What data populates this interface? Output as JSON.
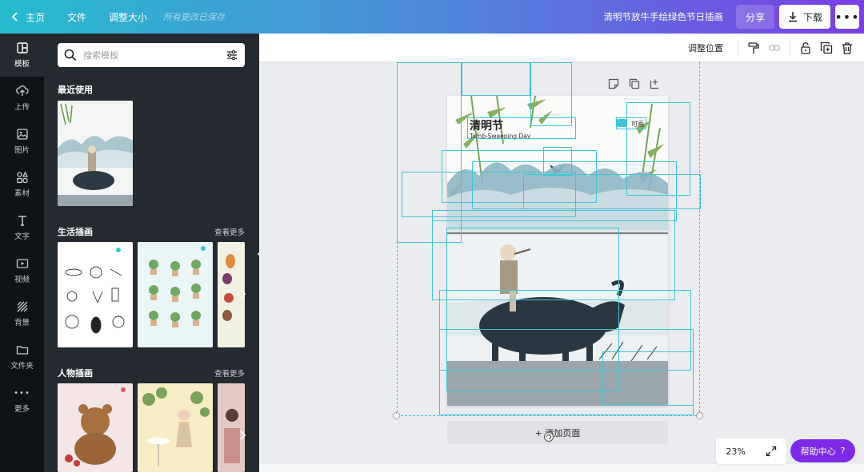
{
  "topbar": {
    "home": "主页",
    "file": "文件",
    "resize": "调整大小",
    "saved_status": "所有更改已保存",
    "doc_title": "清明节放牛手绘绿色节日插画",
    "share": "分享",
    "download": "下载"
  },
  "rail": [
    {
      "label": "模板",
      "icon": "template-icon"
    },
    {
      "label": "上传",
      "icon": "upload-icon"
    },
    {
      "label": "图片",
      "icon": "image-icon"
    },
    {
      "label": "素材",
      "icon": "elements-icon"
    },
    {
      "label": "文字",
      "icon": "text-icon"
    },
    {
      "label": "视频",
      "icon": "video-icon"
    },
    {
      "label": "背景",
      "icon": "background-icon"
    },
    {
      "label": "文件夹",
      "icon": "folder-icon"
    },
    {
      "label": "更多",
      "icon": "more-icon"
    }
  ],
  "panel": {
    "search_placeholder": "搜索模板",
    "recent_title": "最近使用",
    "life_title": "生活插画",
    "people_title": "人物插画",
    "see_more": "查看更多"
  },
  "toolbar2": {
    "position_label": "调整位置"
  },
  "canvas": {
    "page_title_cn": "清明节",
    "page_title_en": "Tomb-Sweeping Day",
    "brand": "可画",
    "add_page": "+ 添加页面"
  },
  "zoom": "23%",
  "help": "帮助中心",
  "help_q": "?",
  "colors": {
    "accent": "#7d2ae8",
    "guide": "#3fc5d3",
    "panel": "#252a31",
    "rail": "#0e1318"
  }
}
